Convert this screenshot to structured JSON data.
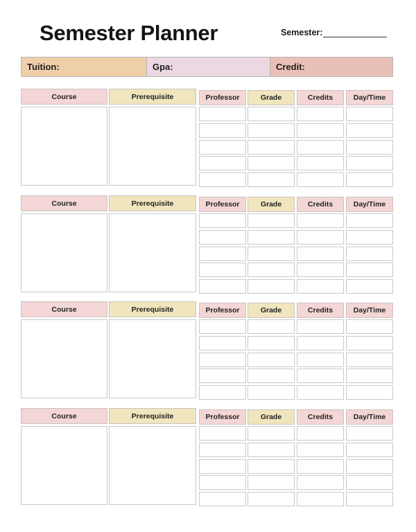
{
  "header": {
    "title": "Semester Planner",
    "semester_label": "Semester:",
    "semester_value": ""
  },
  "info_bar": {
    "tuition_label": "Tuition:",
    "gpa_label": "Gpa:",
    "credit_label": "Credit:",
    "colors": {
      "tuition": "#efcfaa",
      "gpa": "#ecd8e2",
      "credit": "#e9c0b7"
    }
  },
  "columns": {
    "course": "Course",
    "prerequisite": "Prerequisite",
    "professor": "Professor",
    "grade": "Grade",
    "credits": "Credits",
    "day_time": "Day/Time"
  },
  "colors": {
    "header_pink": "#f3d6d5",
    "header_yellow": "#f0e5bd",
    "border": "#c9c9c9"
  },
  "sections": [
    {
      "course": "",
      "prerequisite": "",
      "rows": [
        {
          "professor": "",
          "grade": "",
          "credits": "",
          "day_time": ""
        },
        {
          "professor": "",
          "grade": "",
          "credits": "",
          "day_time": ""
        },
        {
          "professor": "",
          "grade": "",
          "credits": "",
          "day_time": ""
        },
        {
          "professor": "",
          "grade": "",
          "credits": "",
          "day_time": ""
        },
        {
          "professor": "",
          "grade": "",
          "credits": "",
          "day_time": ""
        }
      ]
    },
    {
      "course": "",
      "prerequisite": "",
      "rows": [
        {
          "professor": "",
          "grade": "",
          "credits": "",
          "day_time": ""
        },
        {
          "professor": "",
          "grade": "",
          "credits": "",
          "day_time": ""
        },
        {
          "professor": "",
          "grade": "",
          "credits": "",
          "day_time": ""
        },
        {
          "professor": "",
          "grade": "",
          "credits": "",
          "day_time": ""
        },
        {
          "professor": "",
          "grade": "",
          "credits": "",
          "day_time": ""
        }
      ]
    },
    {
      "course": "",
      "prerequisite": "",
      "rows": [
        {
          "professor": "",
          "grade": "",
          "credits": "",
          "day_time": ""
        },
        {
          "professor": "",
          "grade": "",
          "credits": "",
          "day_time": ""
        },
        {
          "professor": "",
          "grade": "",
          "credits": "",
          "day_time": ""
        },
        {
          "professor": "",
          "grade": "",
          "credits": "",
          "day_time": ""
        },
        {
          "professor": "",
          "grade": "",
          "credits": "",
          "day_time": ""
        }
      ]
    },
    {
      "course": "",
      "prerequisite": "",
      "rows": [
        {
          "professor": "",
          "grade": "",
          "credits": "",
          "day_time": ""
        },
        {
          "professor": "",
          "grade": "",
          "credits": "",
          "day_time": ""
        },
        {
          "professor": "",
          "grade": "",
          "credits": "",
          "day_time": ""
        },
        {
          "professor": "",
          "grade": "",
          "credits": "",
          "day_time": ""
        },
        {
          "professor": "",
          "grade": "",
          "credits": "",
          "day_time": ""
        }
      ]
    }
  ]
}
